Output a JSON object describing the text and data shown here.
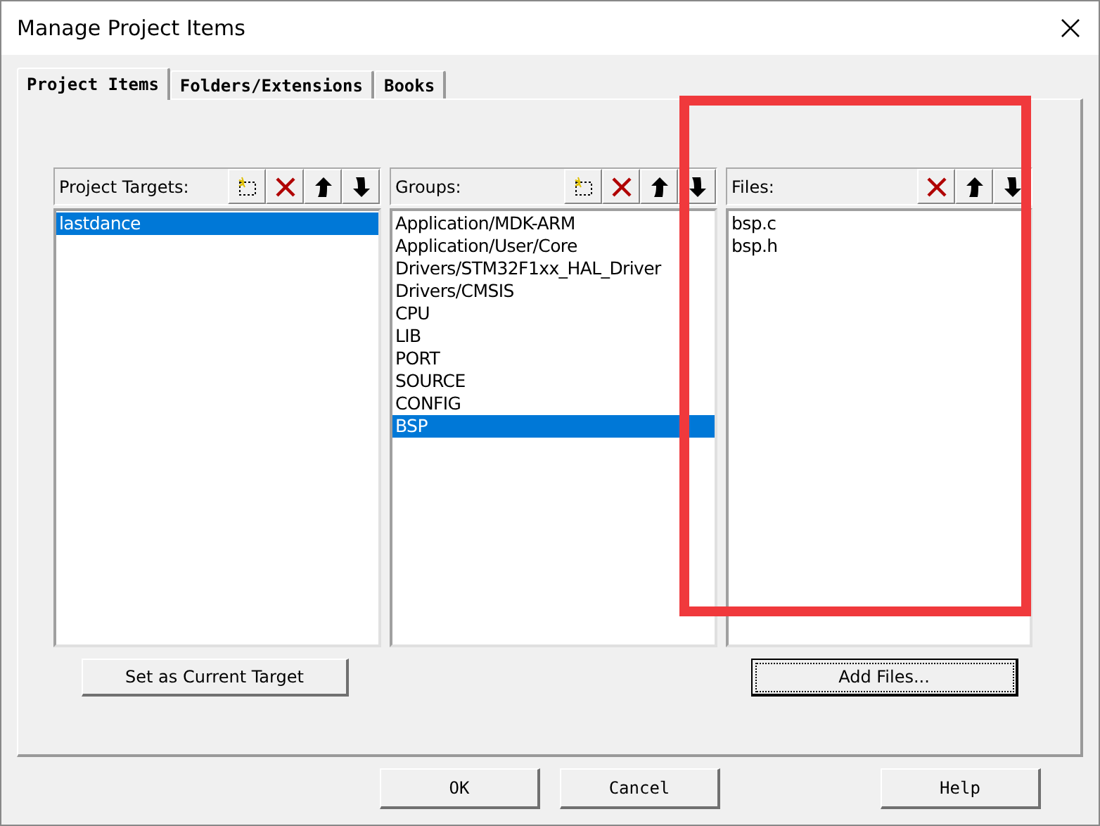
{
  "window": {
    "title": "Manage Project Items"
  },
  "tabs": [
    {
      "label": "Project Items",
      "selected": true
    },
    {
      "label": "Folders/Extensions",
      "selected": false
    },
    {
      "label": "Books",
      "selected": false
    }
  ],
  "panels": [
    {
      "title": "Project Targets:",
      "tools": [
        {
          "kind": "new"
        },
        {
          "kind": "delete"
        },
        {
          "kind": "up"
        },
        {
          "kind": "down"
        }
      ],
      "items": [
        {
          "label": "lastdance",
          "selected": true
        }
      ],
      "button": {
        "label": "Set as Current Target",
        "focused": false
      }
    },
    {
      "title": "Groups:",
      "tools": [
        {
          "kind": "new"
        },
        {
          "kind": "delete"
        },
        {
          "kind": "up"
        },
        {
          "kind": "down"
        }
      ],
      "items": [
        {
          "label": "Application/MDK-ARM",
          "selected": false
        },
        {
          "label": "Application/User/Core",
          "selected": false
        },
        {
          "label": "Drivers/STM32F1xx_HAL_Driver",
          "selected": false
        },
        {
          "label": "Drivers/CMSIS",
          "selected": false
        },
        {
          "label": "CPU",
          "selected": false
        },
        {
          "label": "LIB",
          "selected": false
        },
        {
          "label": "PORT",
          "selected": false
        },
        {
          "label": "SOURCE",
          "selected": false
        },
        {
          "label": "CONFIG",
          "selected": false
        },
        {
          "label": "BSP",
          "selected": true
        }
      ]
    },
    {
      "title": "Files:",
      "tools": [
        {
          "kind": "delete"
        },
        {
          "kind": "up"
        },
        {
          "kind": "down"
        }
      ],
      "items": [
        {
          "label": "bsp.c",
          "selected": false
        },
        {
          "label": "bsp.h",
          "selected": false
        }
      ],
      "button": {
        "label": "Add Files...",
        "focused": true
      }
    }
  ],
  "buttons": [
    "OK",
    "Cancel",
    "Help"
  ],
  "annotations": [
    {
      "kind": "rectangle"
    }
  ]
}
